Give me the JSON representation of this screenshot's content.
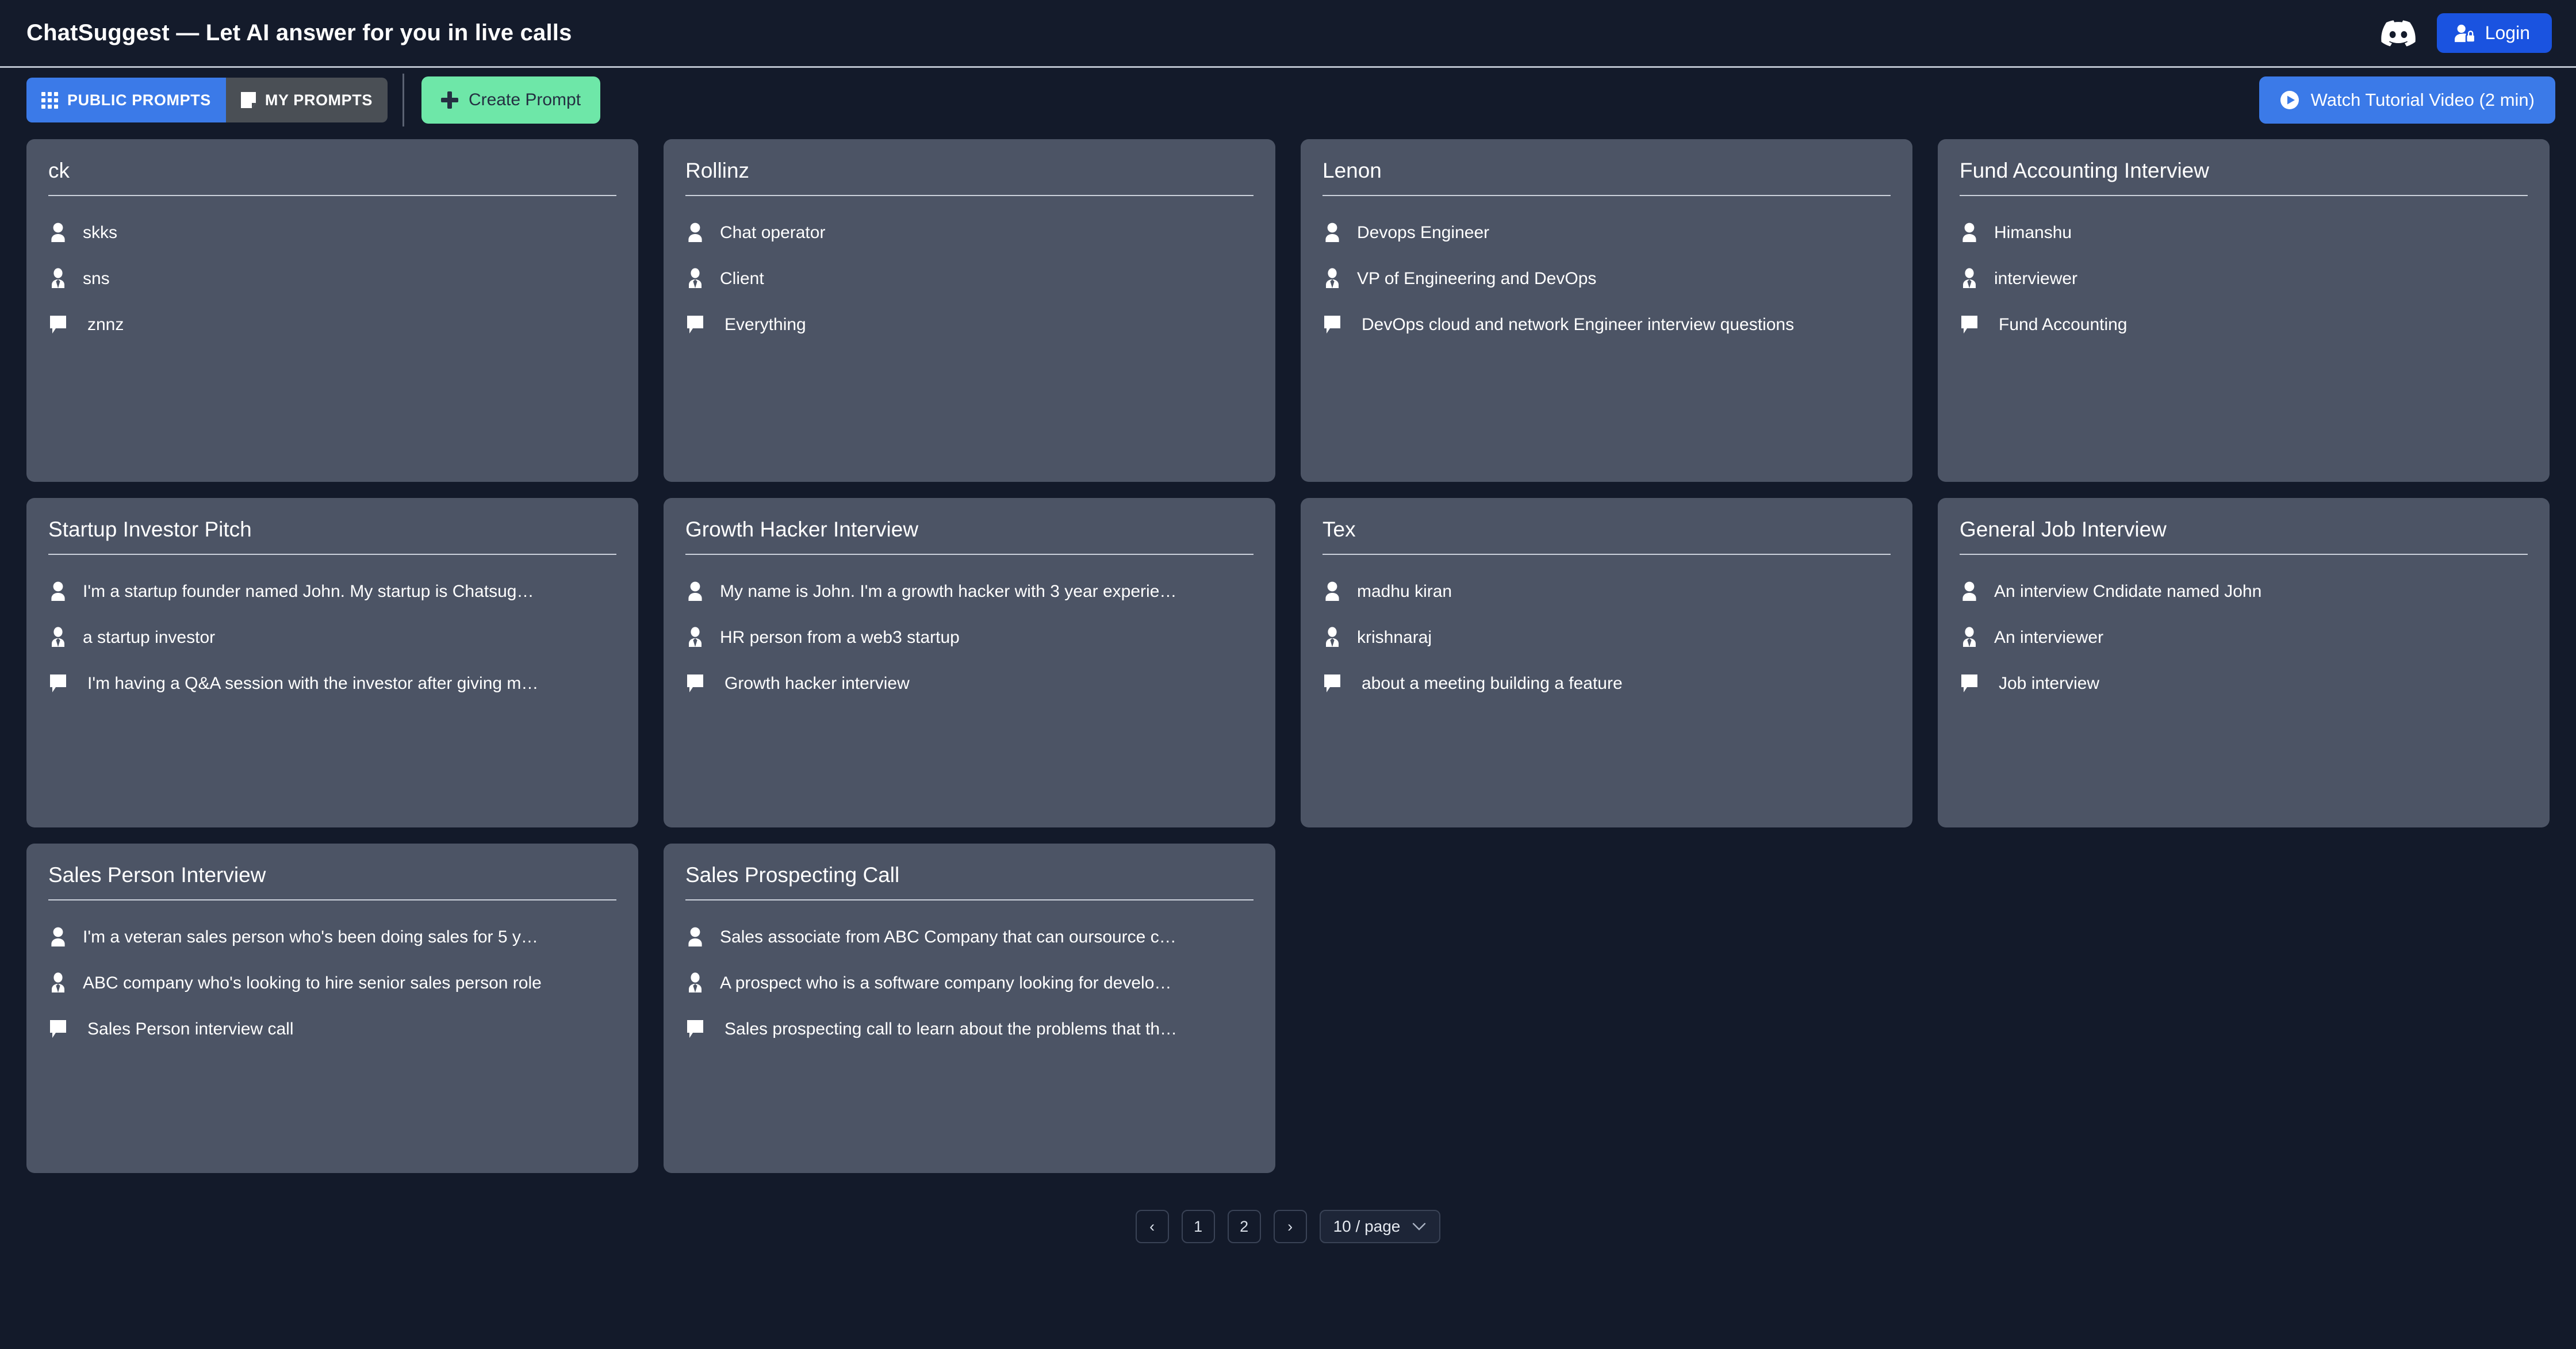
{
  "header": {
    "title": "ChatSuggest — Let AI answer for you in live calls",
    "discord_icon": "discord-icon",
    "login_label": "Login",
    "login_icon": "user-lock-icon",
    "login_color": "#1a53e0"
  },
  "toolbar": {
    "tabs": [
      {
        "label": "PUBLIC PROMPTS",
        "icon": "grid-icon",
        "active": true
      },
      {
        "label": "MY PROMPTS",
        "icon": "document-icon",
        "active": false
      }
    ],
    "create_prompt_label": "Create Prompt",
    "create_prompt_icon": "plus-icon",
    "create_prompt_color": "#6ee7a8",
    "watch_tutorial_label": "Watch Tutorial Video (2 min)",
    "watch_tutorial_icon": "play-circle-icon",
    "watch_tutorial_color": "#3b7ae8",
    "active_tab_color": "#3b7ae8",
    "inactive_tab_color": "#4a4f55"
  },
  "cards": [
    {
      "title": "ck",
      "you": "skks",
      "other": "sns",
      "topic": "znnz"
    },
    {
      "title": "Rollinz",
      "you": "Chat operator",
      "other": "Client",
      "topic": "Everything"
    },
    {
      "title": "Lenon",
      "you": "Devops Engineer",
      "other": "VP of Engineering and DevOps",
      "topic": "DevOps cloud and network Engineer interview questions"
    },
    {
      "title": "Fund Accounting Interview",
      "you": "Himanshu",
      "other": "interviewer",
      "topic": "Fund Accounting"
    },
    {
      "title": "Startup Investor Pitch",
      "you": "I'm a startup founder named John. My startup is Chatsug…",
      "other": "a startup investor",
      "topic": "I'm having a Q&A session with the investor after giving m…"
    },
    {
      "title": "Growth Hacker Interview",
      "you": "My name is John. I'm a growth hacker with 3 year experie…",
      "other": "HR person from a web3 startup",
      "topic": "Growth hacker interview"
    },
    {
      "title": "Tex",
      "you": "madhu kiran",
      "other": "krishnaraj",
      "topic": "about a meeting building a feature"
    },
    {
      "title": "General Job Interview",
      "you": "An interview Cndidate named John",
      "other": "An interviewer",
      "topic": "Job interview"
    },
    {
      "title": "Sales Person Interview",
      "you": "I'm a veteran sales person who's been doing sales for 5 y…",
      "other": "ABC company who's looking to hire senior sales person role",
      "topic": "Sales Person interview call"
    },
    {
      "title": "Sales Prospecting Call",
      "you": "Sales associate from ABC Company that can oursource c…",
      "other": "A prospect who is a software company looking for develo…",
      "topic": "Sales prospecting call to learn about the problems that th…"
    }
  ],
  "card_row_icons": {
    "you": "person-icon",
    "other": "person-tie-icon",
    "topic": "speech-bubble-icon"
  },
  "pagination": {
    "prev_label": "‹",
    "next_label": "›",
    "pages": [
      "1",
      "2"
    ],
    "page_size_label": "10 / page",
    "chevron_icon": "chevron-down-icon"
  },
  "colors": {
    "page_background": "#131a2a",
    "card_background": "#4c5465",
    "header_background": "#141b2b"
  }
}
